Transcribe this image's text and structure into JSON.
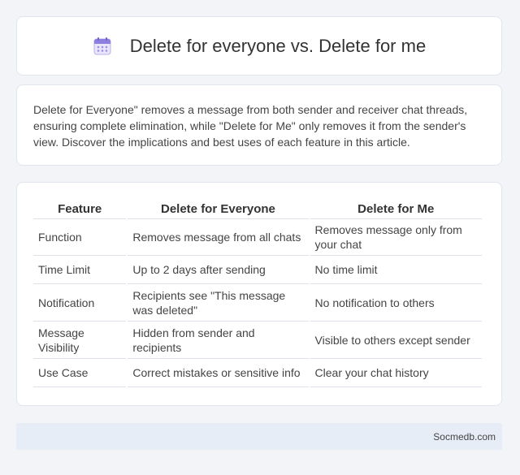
{
  "header": {
    "title": "Delete for everyone vs. Delete for me",
    "icon": "calendar-icon"
  },
  "intro": {
    "text": "Delete for Everyone\" removes a message from both sender and receiver chat threads, ensuring complete elimination, while \"Delete for Me\" only removes it from the sender's view. Discover the implications and best uses of each feature in this article."
  },
  "table": {
    "headers": [
      "Feature",
      "Delete for Everyone",
      "Delete for Me"
    ],
    "rows": [
      [
        "Function",
        "Removes message from all chats",
        "Removes message only from your chat"
      ],
      [
        "Time Limit",
        "Up to 2 days after sending",
        "No time limit"
      ],
      [
        "Notification",
        "Recipients see \"This message was deleted\"",
        "No notification to others"
      ],
      [
        "Message Visibility",
        "Hidden from sender and recipients",
        "Visible to others except sender"
      ],
      [
        "Use Case",
        "Correct mistakes or sensitive info",
        "Clear your chat history"
      ]
    ]
  },
  "footer": {
    "source": "Socmedb.com"
  }
}
